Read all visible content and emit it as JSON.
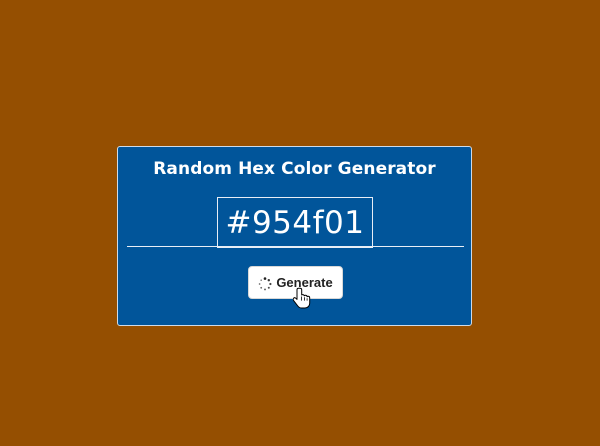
{
  "page": {
    "background_color": "#954f01"
  },
  "card": {
    "title": "Random Hex Color Generator",
    "background_color": "#01559a",
    "hex_value": "#954f01"
  },
  "generate_button": {
    "label": "Generate",
    "icon": "loading-spinner-icon"
  },
  "cursor": {
    "icon": "hand-pointer-icon"
  }
}
